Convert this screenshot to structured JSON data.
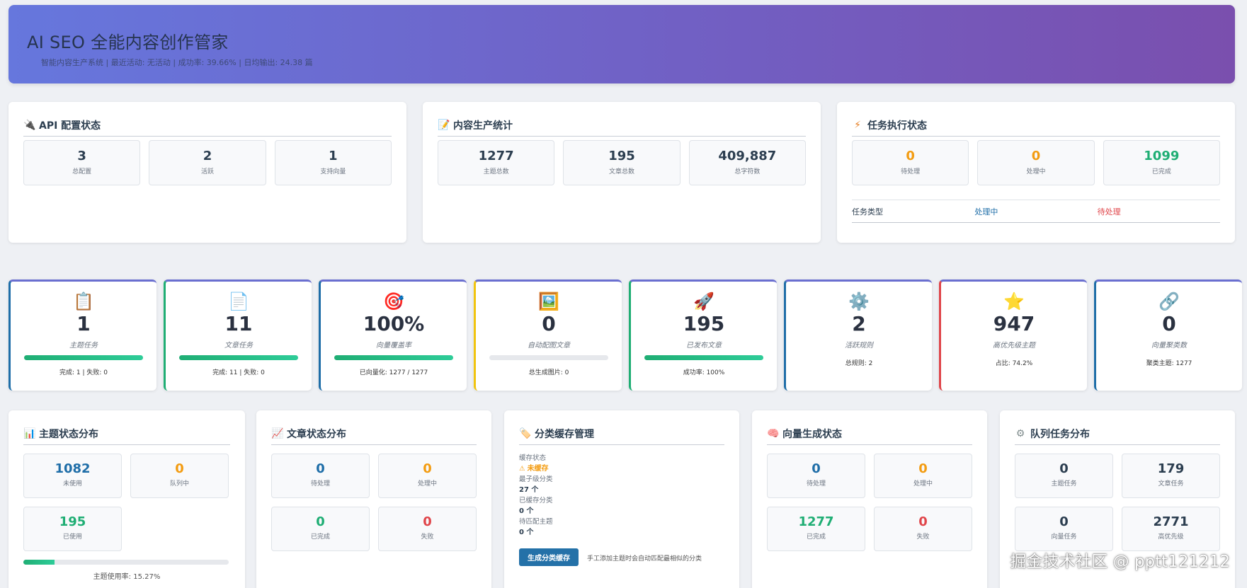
{
  "header": {
    "title": "AI SEO 全能内容创作管家",
    "subtitle": "智能内容生产系统 | 最近活动: 无活动 | 成功率: 39.66% | 日均输出: 24.38 篇"
  },
  "api": {
    "title": "API 配置状态",
    "icon": "plug-icon",
    "items": [
      {
        "value": "3",
        "label": "总配置"
      },
      {
        "value": "2",
        "label": "活跃"
      },
      {
        "value": "1",
        "label": "支持向量"
      }
    ]
  },
  "production": {
    "title": "内容生产统计",
    "icon": "document-icon",
    "items": [
      {
        "value": "1277",
        "label": "主题总数"
      },
      {
        "value": "195",
        "label": "文章总数"
      },
      {
        "value": "409,887",
        "label": "总字符数"
      }
    ]
  },
  "tasks": {
    "title": "任务执行状态",
    "icon": "lightning-icon",
    "items": [
      {
        "value": "0",
        "label": "待处理"
      },
      {
        "value": "0",
        "label": "处理中"
      },
      {
        "value": "1099",
        "label": "已完成"
      }
    ],
    "table_headers": [
      "任务类型",
      "处理中",
      "待处理"
    ]
  },
  "stats": [
    {
      "emoji": "📋",
      "icon": "clipboard-icon",
      "value": "1",
      "label": "主题任务",
      "progress": 1.0,
      "note": "完成: 1 | 失败: 0",
      "border": "#1f6ea8"
    },
    {
      "emoji": "📄",
      "icon": "page-icon",
      "value": "11",
      "label": "文章任务",
      "progress": 1.0,
      "note": "完成: 11 | 失败: 0",
      "border": "#1fae74"
    },
    {
      "emoji": "🎯",
      "icon": "target-icon",
      "value": "100%",
      "label": "向量覆盖率",
      "progress": 1.0,
      "note": "已向量化: 1277 / 1277",
      "border": "#1f6ea8"
    },
    {
      "emoji": "🖼️",
      "icon": "picture-icon",
      "value": "0",
      "label": "自动配图文章",
      "progress": 0.0,
      "note": "总生成图片: 0",
      "border": "#f1c40f"
    },
    {
      "emoji": "🚀",
      "icon": "rocket-icon",
      "value": "195",
      "label": "已发布文章",
      "progress": 1.0,
      "note": "成功率: 100%",
      "border": "#1fae74"
    },
    {
      "emoji": "⚙️",
      "icon": "gear-icon",
      "value": "2",
      "label": "活跃规则",
      "progress": null,
      "note": "总规则: 2",
      "border": "#1f6ea8"
    },
    {
      "emoji": "⭐",
      "icon": "star-icon",
      "value": "947",
      "label": "高优先级主题",
      "progress": null,
      "note": "占比: 74.2%",
      "border": "#e0454a"
    },
    {
      "emoji": "🔗",
      "icon": "link-icon",
      "value": "0",
      "label": "向量聚类数",
      "progress": null,
      "note": "聚类主题: 1277",
      "border": "#1f6ea8"
    }
  ],
  "topic_status": {
    "title": "主题状态分布",
    "icon": "bar-chart-icon",
    "items": [
      {
        "value": "1082",
        "label": "未使用",
        "color": "#1f6ea8"
      },
      {
        "value": "0",
        "label": "队列中",
        "color": "#f39c12"
      },
      {
        "value": "195",
        "label": "已使用",
        "color": "#1fae74"
      }
    ],
    "usage_progress": 0.1527,
    "usage_text": "主题使用率: 15.27%"
  },
  "article_status": {
    "title": "文章状态分布",
    "icon": "line-chart-icon",
    "items": [
      {
        "value": "0",
        "label": "待处理",
        "color": "#1f6ea8"
      },
      {
        "value": "0",
        "label": "处理中",
        "color": "#f39c12"
      },
      {
        "value": "0",
        "label": "已完成",
        "color": "#1fae74"
      },
      {
        "value": "0",
        "label": "失败",
        "color": "#e0454a"
      }
    ]
  },
  "cache": {
    "title": "分类缓存管理",
    "icon": "tag-icon",
    "status_label": "缓存状态",
    "status_value": "未缓存",
    "min_label": "最子级分类",
    "min_value": "27 个",
    "cached_label": "已缓存分类",
    "cached_value": "0 个",
    "pending_label": "待匹配主题",
    "pending_value": "0 个",
    "button": "生成分类缓存",
    "hint": "手工添加主题时会自动匹配最相似的分类"
  },
  "vector": {
    "title": "向量生成状态",
    "icon": "brain-icon",
    "items": [
      {
        "value": "0",
        "label": "待处理",
        "color": "#1f6ea8"
      },
      {
        "value": "0",
        "label": "处理中",
        "color": "#f39c12"
      },
      {
        "value": "1277",
        "label": "已完成",
        "color": "#1fae74"
      },
      {
        "value": "0",
        "label": "失败",
        "color": "#e0454a"
      }
    ]
  },
  "queue": {
    "title": "队列任务分布",
    "icon": "gear-icon",
    "items": [
      {
        "value": "0",
        "label": "主题任务"
      },
      {
        "value": "179",
        "label": "文章任务"
      },
      {
        "value": "0",
        "label": "向量任务"
      },
      {
        "value": "2771",
        "label": "高优先级"
      }
    ]
  },
  "watermark": "掘金技术社区 @ pptt121212"
}
